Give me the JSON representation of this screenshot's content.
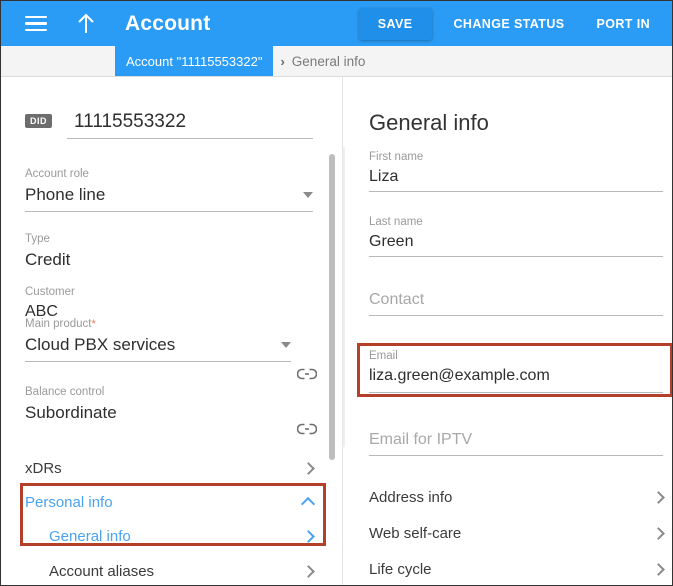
{
  "colors": {
    "brand_blue": "#2b9cf5",
    "save_blue": "#1f8fea",
    "highlight_red": "#b5402a",
    "link_blue": "#4aa3f0",
    "required_red": "#f4745c",
    "badge_gray": "#6d6d6d"
  },
  "topbar": {
    "menu_icon": "hamburger-menu-icon",
    "back_icon": "up-arrow-icon",
    "title": "Account",
    "save_label": "SAVE",
    "change_status_label": "CHANGE STATUS",
    "port_in_label": "PORT IN"
  },
  "breadcrumb": {
    "parent": "Account \"11115553322\"",
    "separator": "›",
    "current": "General info"
  },
  "left_panel": {
    "did": {
      "badge": "DID",
      "value": "11115553322"
    },
    "account_role": {
      "label": "Account role",
      "value": "Phone line",
      "dropdown_icon": "chevron-down-icon"
    },
    "type": {
      "label": "Type",
      "value": "Credit"
    },
    "customer": {
      "label": "Customer",
      "value": "ABC",
      "link_icon": "link-icon"
    },
    "main_product": {
      "label": "Main product",
      "required_marker": "*",
      "value": "Cloud PBX services",
      "dropdown_icon": "chevron-down-icon",
      "link_icon": "link-icon"
    },
    "balance_control": {
      "label": "Balance control",
      "value": "Subordinate"
    },
    "nav_items": [
      {
        "label": "xDRs",
        "icon": "chevron-right-icon",
        "state": "normal"
      },
      {
        "label": "Personal info",
        "icon": "chevron-up-icon",
        "state": "expanded-selected"
      },
      {
        "label": "General info",
        "icon": "chevron-right-icon",
        "state": "selected-child"
      },
      {
        "label": "Account aliases",
        "icon": "chevron-right-icon",
        "state": "child"
      }
    ]
  },
  "right_panel": {
    "title": "General info",
    "fields": [
      {
        "label": "First name",
        "value": "Liza",
        "placeholder": ""
      },
      {
        "label": "Last name",
        "value": "Green",
        "placeholder": ""
      },
      {
        "label": "",
        "value": "",
        "placeholder": "Contact"
      },
      {
        "label": "Email",
        "value": "liza.green@example.com",
        "placeholder": ""
      },
      {
        "label": "",
        "value": "",
        "placeholder": "Email for IPTV"
      }
    ],
    "nav_items": [
      {
        "label": "Address info",
        "icon": "chevron-right-icon"
      },
      {
        "label": "Web self-care",
        "icon": "chevron-right-icon"
      },
      {
        "label": "Life cycle",
        "icon": "chevron-right-icon"
      }
    ]
  }
}
